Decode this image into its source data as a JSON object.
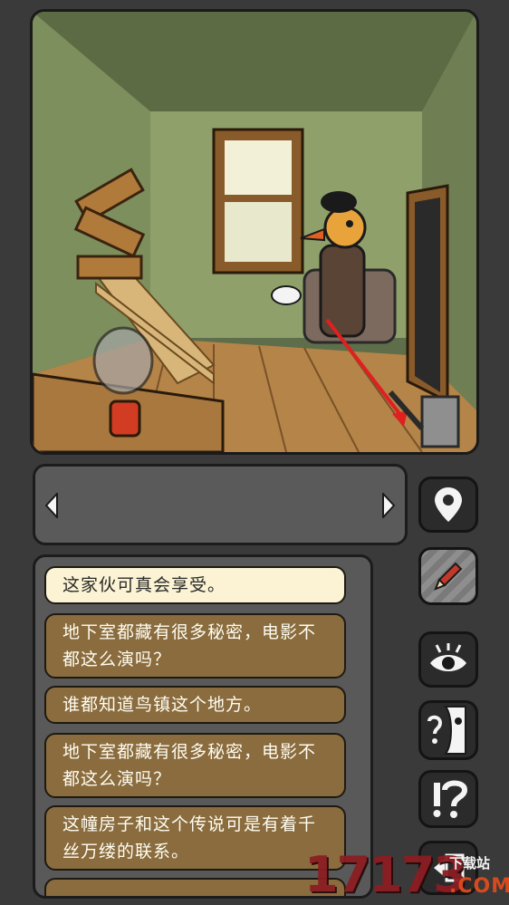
{
  "scene": {
    "description_icon": "room-scene",
    "arrow_color": "#e02020"
  },
  "inventory": {
    "left_arrow": "◀",
    "right_arrow": "▶"
  },
  "dialogue": {
    "options": [
      {
        "label": "这家伙可真会享受。",
        "line2": ""
      },
      {
        "label": "地下室都藏有很多秘密，电影不",
        "line2": "都这么演吗？"
      },
      {
        "label": "谁都知道鸟镇这个地方。",
        "line2": ""
      },
      {
        "label": "地下室都藏有很多秘密，电影不",
        "line2": "都这么演吗？"
      },
      {
        "label": "这幢房子和这个传说可是有着千",
        "line2": "丝万缕的联系。"
      }
    ]
  },
  "side_buttons": [
    {
      "name": "map-pin-icon"
    },
    {
      "name": "pencil-icon"
    },
    {
      "name": "eye-icon"
    },
    {
      "name": "talk-face-icon"
    },
    {
      "name": "question-exclaim-icon"
    },
    {
      "name": "exit-icon"
    }
  ],
  "watermark": {
    "number": "17173",
    "site": "下载站",
    "com": ".COM"
  }
}
